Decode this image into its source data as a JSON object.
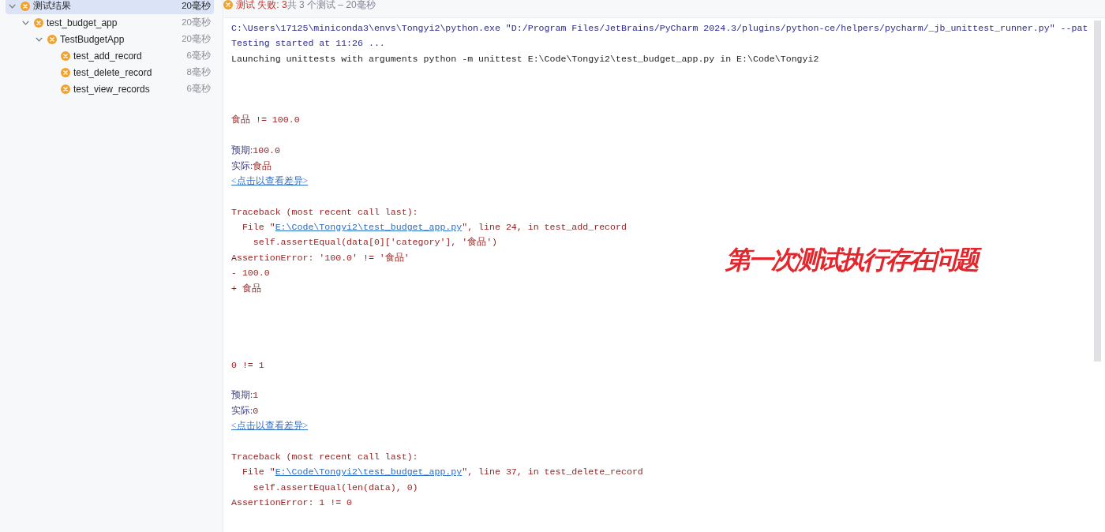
{
  "sidebar": {
    "tree": [
      {
        "label": "测试结果",
        "time": "20毫秒",
        "failed": true,
        "selected": true,
        "expanded": true,
        "children": [
          {
            "label": "test_budget_app",
            "time": "20毫秒",
            "failed": true,
            "selected": false,
            "expanded": true,
            "children": [
              {
                "label": "TestBudgetApp",
                "time": "20毫秒",
                "failed": true,
                "selected": false,
                "expanded": true,
                "children": [
                  {
                    "label": "test_add_record",
                    "time": "6毫秒",
                    "failed": true,
                    "selected": false
                  },
                  {
                    "label": "test_delete_record",
                    "time": "8毫秒",
                    "failed": true,
                    "selected": false
                  },
                  {
                    "label": "test_view_records",
                    "time": "6毫秒",
                    "failed": true,
                    "selected": false
                  }
                ]
              }
            ]
          }
        ]
      }
    ]
  },
  "header": {
    "failed": true,
    "result": "测试 失败: 3",
    "summary": "共 3 个测试 – 20毫秒"
  },
  "console": {
    "lines": [
      {
        "kind": "system",
        "text": "C:\\Users\\17125\\miniconda3\\envs\\Tongyi2\\python.exe \"D:/Program Files/JetBrains/PyCharm 2024.3/plugins/python-ce/helpers/pycharm/_jb_unittest_runner.py\" --pat"
      },
      {
        "kind": "system",
        "text": "Testing started at 11:26 ..."
      },
      {
        "kind": "stdout",
        "text": "Launching unittests with arguments python -m unittest E:\\Code\\Tongyi2\\test_budget_app.py in E:\\Code\\Tongyi2"
      }
    ],
    "failures": [
      {
        "message": "食品 != 100.0",
        "expected_label": "预期:",
        "expected": "100.0",
        "actual_label": "实际:",
        "actual": "食品",
        "diff_link": "<点击以查看差异>",
        "traceback": [
          {
            "kind": "header",
            "text": "Traceback (most recent call last):"
          },
          {
            "kind": "file",
            "prefix": "File \"",
            "link": "E:\\Code\\Tongyi2\\test_budget_app.py",
            "suffix": "\", line 24, in test_add_record"
          },
          {
            "kind": "code",
            "text": "self.assertEqual(data[0]['category'], '食品')"
          },
          {
            "kind": "error",
            "text": "AssertionError: '100.0' != '食品'"
          },
          {
            "kind": "error",
            "text": "- 100.0"
          },
          {
            "kind": "error",
            "text": "+ 食品"
          }
        ]
      },
      {
        "message": "0 != 1",
        "expected_label": "预期:",
        "expected": "1",
        "actual_label": "实际:",
        "actual": "0",
        "diff_link": "<点击以查看差异>",
        "traceback": [
          {
            "kind": "header",
            "text": "Traceback (most recent call last):"
          },
          {
            "kind": "file",
            "prefix": "File \"",
            "link": "E:\\Code\\Tongyi2\\test_budget_app.py",
            "suffix": "\", line 37, in test_delete_record"
          },
          {
            "kind": "code",
            "text": "self.assertEqual(len(data), 0)"
          },
          {
            "kind": "error",
            "text": "AssertionError: 1 != 0"
          }
        ]
      }
    ]
  },
  "annotation": {
    "text": "第一次测试执行存在问题"
  }
}
